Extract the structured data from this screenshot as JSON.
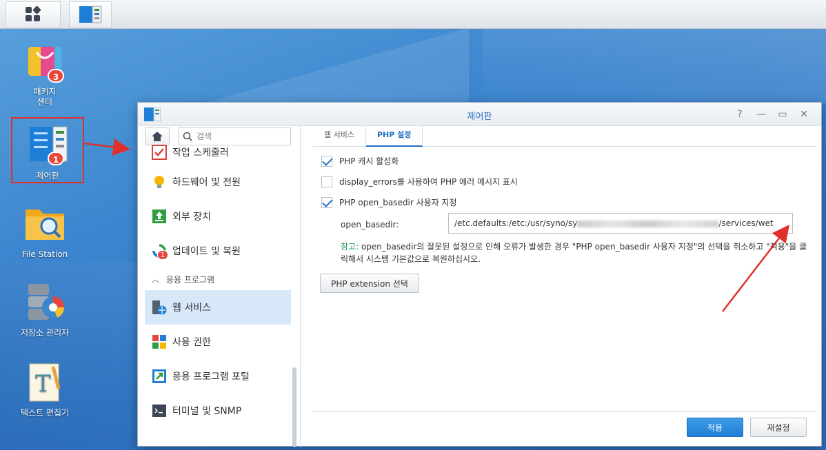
{
  "desktop": {
    "icons": [
      {
        "label_lines": [
          "패키지",
          "센터"
        ],
        "badge": "3"
      },
      {
        "label_lines": [
          "제어판"
        ],
        "badge": "1"
      },
      {
        "label_lines": [
          "File Station"
        ]
      },
      {
        "label_lines": [
          "저장소 관리자"
        ]
      },
      {
        "label_lines": [
          "텍스트 편집기"
        ]
      }
    ]
  },
  "window": {
    "title": "제어판",
    "help_glyph": "?",
    "minimize_glyph": "—",
    "maximize_glyph": "▭",
    "close_glyph": "✕"
  },
  "sidebar": {
    "search_placeholder": "검색",
    "items": [
      {
        "label": "작업 스케줄러",
        "icon": "task-scheduler-icon"
      },
      {
        "label": "하드웨어 및 전원",
        "icon": "lightbulb-icon"
      },
      {
        "label": "외부 장치",
        "icon": "external-device-icon"
      },
      {
        "label": "업데이트 및 복원",
        "icon": "update-icon",
        "badge": "1"
      }
    ],
    "section_header": "응용 프로그램",
    "app_items": [
      {
        "label": "웹 서비스",
        "icon": "web-service-icon",
        "active": true
      },
      {
        "label": "사용 권한",
        "icon": "privileges-icon"
      },
      {
        "label": "응용 프로그램 포털",
        "icon": "app-portal-icon"
      },
      {
        "label": "터미널 및 SNMP",
        "icon": "terminal-icon"
      }
    ]
  },
  "main": {
    "tabs": [
      {
        "label": "웹 서비스",
        "active": false
      },
      {
        "label": "PHP 설정",
        "active": true
      }
    ],
    "options": [
      {
        "label": "PHP 캐시 활성화",
        "checked": true
      },
      {
        "label": "display_errors를 사용하여 PHP 에러 메시지 표시",
        "checked": false
      },
      {
        "label": "PHP open_basedir 사용자 지정",
        "checked": true
      }
    ],
    "basedir_label": "open_basedir:",
    "basedir_value_start": "/etc.defaults:/etc:/usr/syno/sy",
    "basedir_value_end": "/services/wet",
    "note_label": "참고:",
    "note_text": " open_basedir의 잘못된 설정으로 인해 오류가 발생한 경우 \"PHP open_basedir 사용자 지정\"의 선택을 취소하고 \"적용\"을 클릭해서 시스템 기본값으로 복원하십시오.",
    "ext_button": "PHP extension 선택",
    "apply_button": "적용",
    "reset_button": "재설정"
  },
  "colors": {
    "accent": "#1f6fc4",
    "highlight": "#e0302a",
    "badge": "#e8453c",
    "note_label": "#1e9e5a"
  }
}
